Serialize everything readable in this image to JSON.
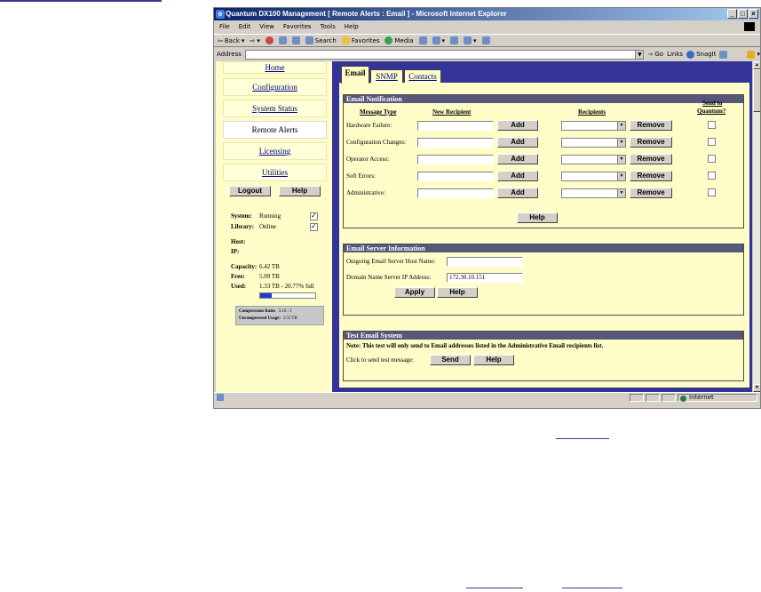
{
  "window": {
    "title": "Quantum DX100 Management [ Remote Alerts : Email ] - Microsoft Internet Explorer",
    "controls": [
      "_",
      "□",
      "×"
    ]
  },
  "menu": [
    "File",
    "Edit",
    "View",
    "Favorites",
    "Tools",
    "Help"
  ],
  "toolbar": {
    "back": "Back",
    "search": "Search",
    "favorites": "Favorites",
    "media": "Media"
  },
  "address": {
    "label": "Address",
    "value": "",
    "go": "Go",
    "links": "Links",
    "snagit": "SnagIt"
  },
  "nav": {
    "items": [
      "Home",
      "Configuration",
      "System Status",
      "Remote Alerts",
      "Licensing",
      "Utilities"
    ],
    "active": "Remote Alerts",
    "logout": "Logout",
    "help": "Help"
  },
  "status": {
    "system_label": "System:",
    "system_value": "Running",
    "library_label": "Library:",
    "library_value": "Online",
    "host_label": "Host:",
    "ip_label": "IP:",
    "capacity_label": "Capacity:",
    "capacity_value": "6.42 TB",
    "free_label": "Free:",
    "free_value": "5.09 TB",
    "used_label": "Used:",
    "used_value": "1.33 TB - 20.77% full",
    "used_fraction": 0.2077,
    "compression_label": "Compression Ratio",
    "compression_value": "3.16 : 1",
    "uncompressed_label": "Uncompressed Usage:",
    "uncompressed_value": "3.55 TB"
  },
  "tabs": [
    "Email",
    "SNMP",
    "Contacts"
  ],
  "email_notification": {
    "title": "Email Notification",
    "col_type": "Message Type",
    "col_new": "New Recipient",
    "col_recipients": "Recipients",
    "col_send1": "Send to",
    "col_send2": "Quantum?",
    "rows": [
      {
        "type": "Hardware Failure:"
      },
      {
        "type": "Configuration Changes:"
      },
      {
        "type": "Operator Access:"
      },
      {
        "type": "Soft Errors:"
      },
      {
        "type": "Administrative:"
      }
    ],
    "add": "Add",
    "remove": "Remove",
    "help": "Help"
  },
  "email_server": {
    "title": "Email Server Information",
    "host_label": "Outgoing Email Server Host Name:",
    "host_value": "",
    "dns_label": "Domain Name Server IP Address:",
    "dns_value": "172.30.10.151",
    "apply": "Apply",
    "help": "Help"
  },
  "test_email": {
    "title": "Test Email System",
    "note": "Note: This test will only send to Email addresses listed in the Administrative Email recipients list.",
    "click_label": "Click to send test message:",
    "send": "Send",
    "help": "Help"
  },
  "statusbar": {
    "zone": "Internet"
  }
}
